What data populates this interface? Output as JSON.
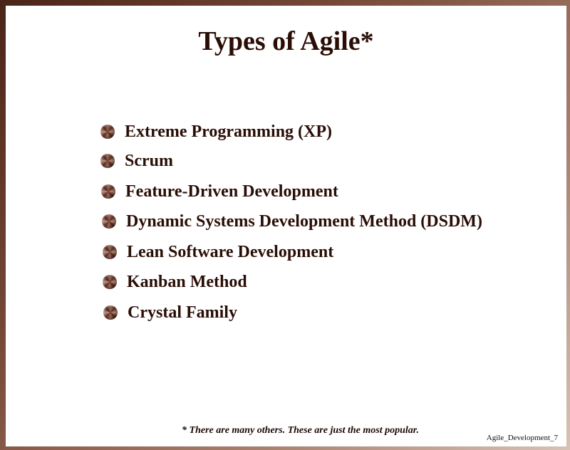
{
  "slide": {
    "title": "Types of Agile*",
    "items": [
      {
        "label": "Extreme Programming (XP)"
      },
      {
        "label": "Scrum"
      },
      {
        "label": "Feature-Driven Development"
      },
      {
        "label": "Dynamic Systems Development Method (DSDM)"
      },
      {
        "label": "Lean Software Development"
      },
      {
        "label": "Kanban Method"
      },
      {
        "label": "Crystal Family"
      }
    ],
    "footnote": "* There are many others.  These are just the most popular.",
    "slide_id": "Agile_Development_7"
  },
  "colors": {
    "text": "#2a0e06",
    "frame": "#7a4a3a",
    "bullet": "#5a2e22"
  },
  "icons": {
    "bullet": "bronze-sphere-bullet-icon"
  }
}
